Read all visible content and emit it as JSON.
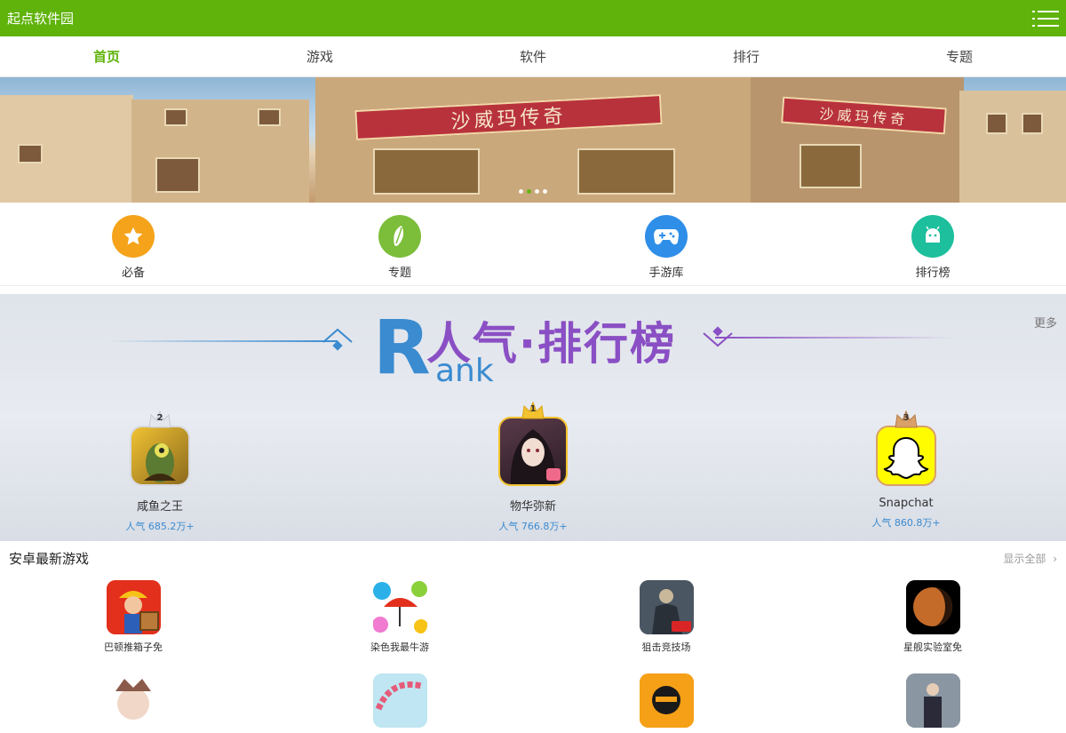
{
  "header": {
    "title": "起点软件园",
    "menu_icon": "menu-icon"
  },
  "nav": {
    "tabs": [
      {
        "label": "首页",
        "active": true
      },
      {
        "label": "游戏"
      },
      {
        "label": "软件"
      },
      {
        "label": "排行"
      },
      {
        "label": "专题"
      }
    ]
  },
  "banner": {
    "sign_text": "沙威玛传奇",
    "sign_text_small": "沙威玛传奇",
    "dots": 4,
    "active_dot": 1
  },
  "quick": [
    {
      "label": "必备",
      "icon": "star-icon",
      "color": "#f5a31a"
    },
    {
      "label": "专题",
      "icon": "leaf-icon",
      "color": "#7cbd3a"
    },
    {
      "label": "手游库",
      "icon": "gamepad-icon",
      "color": "#2f8ee8"
    },
    {
      "label": "排行榜",
      "icon": "android-icon",
      "color": "#1dbf9c"
    }
  ],
  "rank": {
    "more": "更多",
    "title": "人气·排行榜",
    "logo_letter": "R",
    "logo_rest": "ank",
    "items": [
      {
        "rank": "2",
        "name": "咸鱼之王",
        "popularity": "人气 685.2万+"
      },
      {
        "rank": "1",
        "name": "物华弥新",
        "popularity": "人气 766.8万+"
      },
      {
        "rank": "3",
        "name": "Snapchat",
        "popularity": "人气 860.8万+"
      }
    ]
  },
  "latest": {
    "title": "安卓最新游戏",
    "show_all": "显示全部",
    "games": [
      {
        "name": "巴顿推箱子免"
      },
      {
        "name": "染色我最牛游"
      },
      {
        "name": "狙击竞技场"
      },
      {
        "name": "星舰实验室免"
      },
      {
        "name": ""
      },
      {
        "name": ""
      },
      {
        "name": ""
      },
      {
        "name": ""
      }
    ]
  },
  "colors": {
    "brand": "#5fb30a",
    "rank_blue": "#3a8bd0",
    "rank_purple": "#8a4fc4"
  }
}
